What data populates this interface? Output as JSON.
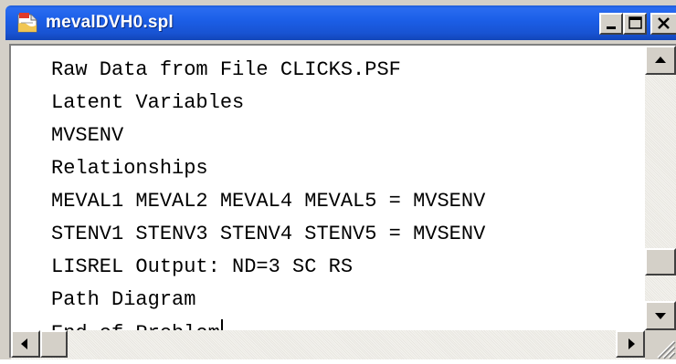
{
  "window": {
    "title": "mevalDVH0.spl",
    "title_bar_color": "#1c5fe8",
    "icon": "document-icon",
    "buttons": [
      "minimize-icon",
      "maximize-icon",
      "close-icon"
    ]
  },
  "editor": {
    "lines": [
      "Raw Data from File CLICKS.PSF",
      "Latent Variables",
      "MVSENV",
      "Relationships",
      "MEVAL1 MEVAL2 MEVAL4 MEVAL5 = MVSENV",
      "STENV1 STENV3 STENV4 STENV5 = MVSENV",
      "LISREL Output: ND=3 SC RS",
      "Path Diagram",
      "End of Problem"
    ]
  },
  "scrollbars": {
    "vertical": [
      "up-arrow-icon",
      "down-arrow-icon"
    ],
    "horizontal": [
      "left-arrow-icon",
      "right-arrow-icon"
    ]
  }
}
